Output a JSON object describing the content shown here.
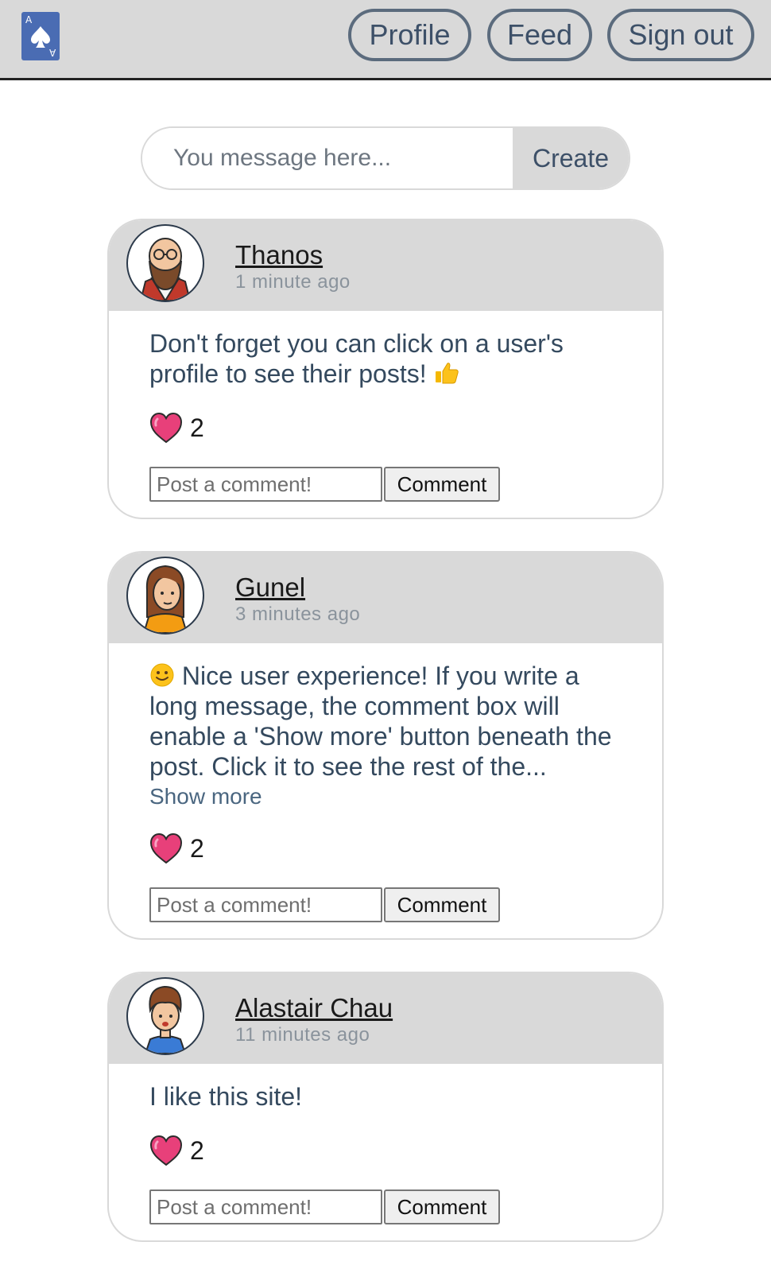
{
  "nav": {
    "profile": "Profile",
    "feed": "Feed",
    "signout": "Sign out",
    "logo_letter": "A"
  },
  "composer": {
    "placeholder": "You message here...",
    "button": "Create"
  },
  "posts": [
    {
      "author": "Thanos",
      "time": "1 minute ago",
      "message": "Don't forget you can click on a user's profile to see their posts!",
      "likes": "2",
      "comment_placeholder": "Post a comment!",
      "comment_button": "Comment"
    },
    {
      "author": "Gunel",
      "time": "3 minutes ago",
      "message": "Nice user experience! If you write a long message, the comment box will enable a 'Show more' button beneath the post. Click it to see the rest of the...",
      "show_more": "Show more",
      "likes": "2",
      "comment_placeholder": "Post a comment!",
      "comment_button": "Comment"
    },
    {
      "author": "Alastair Chau",
      "time": "11 minutes ago",
      "message": "I like this site!",
      "likes": "2",
      "comment_placeholder": "Post a comment!",
      "comment_button": "Comment"
    }
  ],
  "colors": {
    "topbar": "#d9d9d9",
    "logo": "#4a6cb3",
    "text": "#34495e",
    "heart": "#e8407a"
  },
  "icons": [
    "ace-of-spades-logo",
    "heart-icon",
    "thumbs-up-emoji",
    "smile-emoji"
  ]
}
